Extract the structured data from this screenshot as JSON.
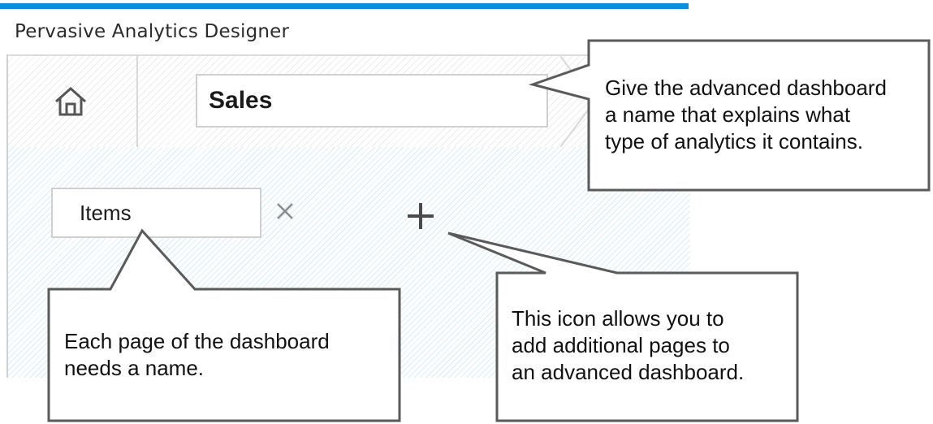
{
  "app": {
    "title": "Pervasive Analytics Designer"
  },
  "dashboard": {
    "name_value": "Sales",
    "home_icon": "home-icon"
  },
  "pages": {
    "tabs": [
      {
        "label": "Items"
      }
    ],
    "close_icon": "close-icon",
    "add_icon": "plus-icon"
  },
  "callouts": {
    "name": "Give the advanced dashboard\na name that explains what\ntype of analytics it contains.",
    "page": "Each page of the dashboard\nneeds a name.",
    "add": "This icon allows you to\nadd additional pages to\nan advanced dashboard."
  },
  "colors": {
    "accent": "#0a8fdc",
    "content_hatch": "#d6eef5",
    "callout_border": "#5a5a5a"
  }
}
